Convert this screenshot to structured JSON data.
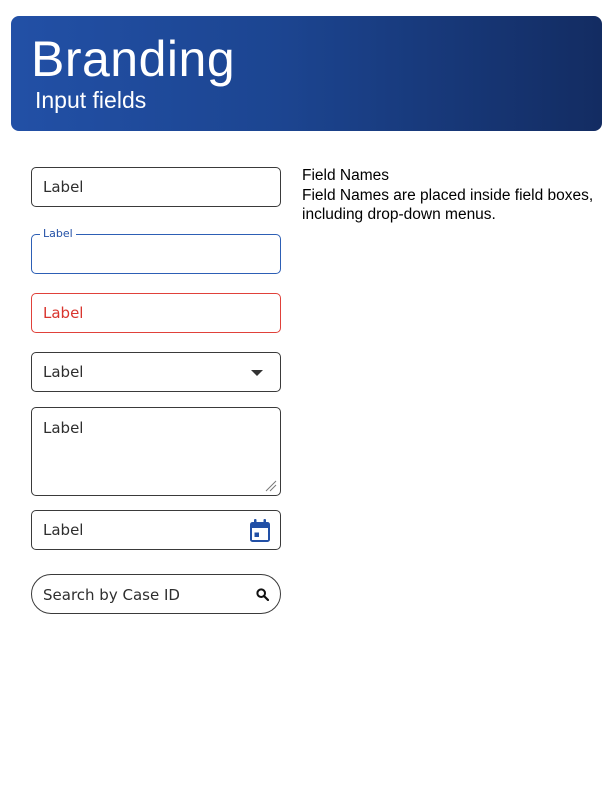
{
  "header": {
    "title": "Branding",
    "subtitle": "Input fields"
  },
  "fields": {
    "default": {
      "label": "Label"
    },
    "focused": {
      "floating_label": "Label",
      "value": ""
    },
    "error": {
      "label": "Label"
    },
    "dropdown": {
      "label": "Label",
      "icon": "caret-down-icon"
    },
    "textarea": {
      "label": "Label",
      "icon": "resize-handle-icon"
    },
    "date": {
      "label": "Label",
      "icon": "calendar-icon"
    },
    "search": {
      "placeholder": "Search by Case ID",
      "icon": "search-icon"
    }
  },
  "description": {
    "heading": "Field Names",
    "line1": "Field Names are placed inside field boxes,",
    "line2": "including drop-down menus."
  },
  "colors": {
    "banner_start": "#2250a6",
    "banner_end": "#132c62",
    "focus": "#2d5fb5",
    "error": "#e0413a",
    "calendar_icon": "#2250a6"
  }
}
